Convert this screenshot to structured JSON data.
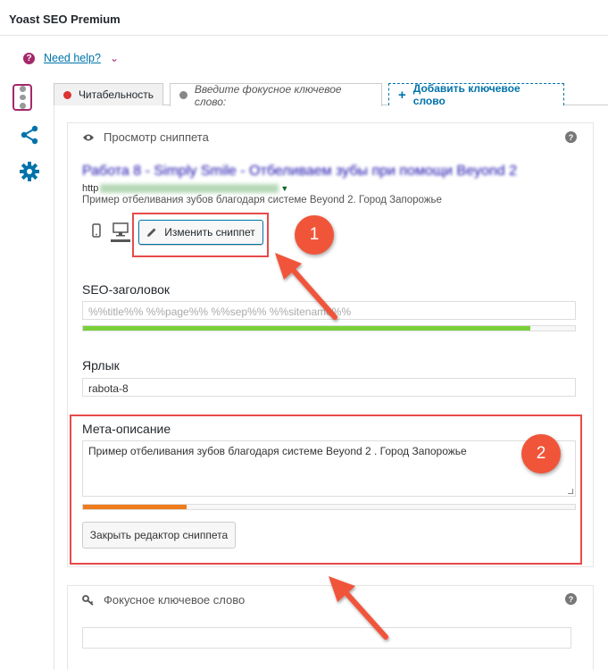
{
  "app": {
    "title": "Yoast SEO Premium"
  },
  "help": {
    "label": "Need help?"
  },
  "tabs": {
    "readability": "Читабельность",
    "focus_keyword": "Введите фокусное ключевое слово:",
    "add_keyword": "Добавить ключевое слово"
  },
  "snippet": {
    "heading": "Просмотр сниппета",
    "title": "Работа 8 - Simply Smile - Отбеливаем зубы при помощи Beyond 2",
    "url_prefix": "http",
    "description": "Пример отбеливания зубов благодаря системе Beyond 2. Город Запорожье",
    "edit_button": "Изменить сниппет"
  },
  "editor": {
    "seo_title_label": "SEO-заголовок",
    "seo_title_value": "%%title%% %%page%% %%sep%% %%sitename%%",
    "slug_label": "Ярлык",
    "slug_value": "rabota-8",
    "meta_label": "Мета-описание",
    "meta_value": "Пример отбеливания зубов благодаря системе Beyond 2 . Город Запорожье",
    "close_button": "Закрыть редактор сниппета",
    "seo_title_progress": 0.91,
    "meta_progress": 0.21
  },
  "focus_keyword": {
    "heading": "Фокусное ключевое слово",
    "value": ""
  },
  "annotations": {
    "badge1": "1",
    "badge2": "2"
  },
  "colors": {
    "brand": "#a4286a",
    "link": "#0073aa",
    "good": "#7ad03a",
    "ok": "#ee7c1b",
    "annotation": "#f0553a",
    "bad": "#dc3232"
  }
}
